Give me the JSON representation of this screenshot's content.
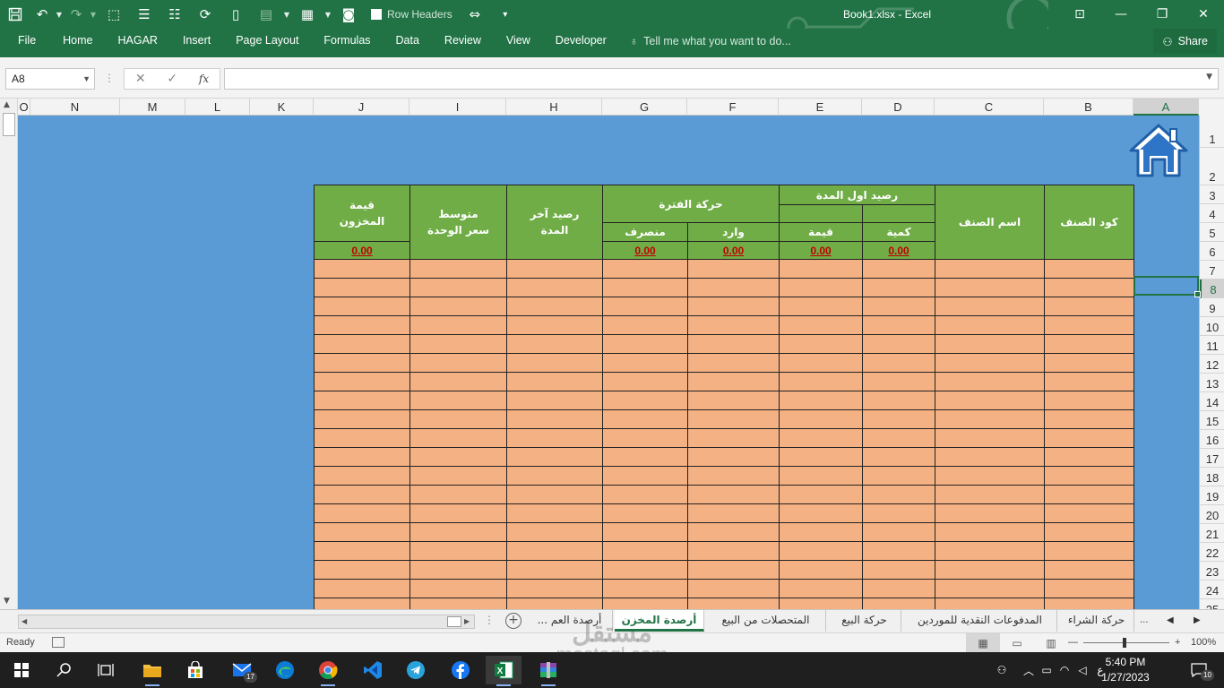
{
  "window": {
    "title": "Book1.xlsx - Excel",
    "row_headers_label": "Row Headers"
  },
  "ribbon": {
    "tabs": [
      "File",
      "Home",
      "HAGAR",
      "Insert",
      "Page Layout",
      "Formulas",
      "Data",
      "Review",
      "View",
      "Developer"
    ],
    "tell_me_placeholder": "Tell me what you want to do...",
    "share_label": "Share"
  },
  "formula_bar": {
    "name_box": "A8",
    "fx_label": "fx",
    "formula_value": ""
  },
  "columns": [
    "O",
    "N",
    "M",
    "L",
    "K",
    "J",
    "I",
    "H",
    "G",
    "F",
    "E",
    "D",
    "C",
    "B",
    "A"
  ],
  "selected_column": "A",
  "rows": [
    1,
    2,
    3,
    4,
    5,
    6,
    7,
    8,
    9,
    10,
    11,
    12,
    13,
    14,
    15,
    16,
    17,
    18,
    19,
    20,
    21,
    22,
    23,
    24,
    25
  ],
  "selected_row": 8,
  "table": {
    "item_code": "كود الصنف",
    "item_name": "اسم الصنف",
    "opening_balance": "رصيد اول المدة",
    "quantity": "كمية",
    "value": "قيمة",
    "period_movement": "حركة الفترة",
    "incoming": "وارد",
    "outgoing": "منصرف",
    "closing_balance": "رصيد آخر المدة",
    "avg_unit_price": "متوسط سعر الوحدة",
    "stock_value": "قيمة المخزون",
    "totals": {
      "quantity": "0.00",
      "value": "0.00",
      "incoming": "0.00",
      "outgoing": "0.00",
      "stock_value": "0.00"
    }
  },
  "sheets": {
    "tabs": [
      "حركة الشراء",
      "المدفوعات النقدية للموردين",
      "حركة البيع",
      "المتحصلات من البيع",
      "أرصدة المخزن",
      "أرصدة العم"
    ],
    "active": "أرصدة المخزن",
    "more_left": "...",
    "more_right": "..."
  },
  "status": {
    "ready": "Ready",
    "zoom": "100%"
  },
  "taskbar": {
    "time": "5:40 PM",
    "date": "1/27/2023",
    "mail_badge": "17",
    "notification_count": "10",
    "lang": "ع"
  },
  "watermark": {
    "arabic": "مستقل",
    "latin": "mostaql.com"
  },
  "colors": {
    "excel_green": "#217346",
    "sheet_bg": "#5b9bd5",
    "header_green": "#70ad47",
    "data_orange": "#f4b183",
    "total_red": "#c00000"
  }
}
